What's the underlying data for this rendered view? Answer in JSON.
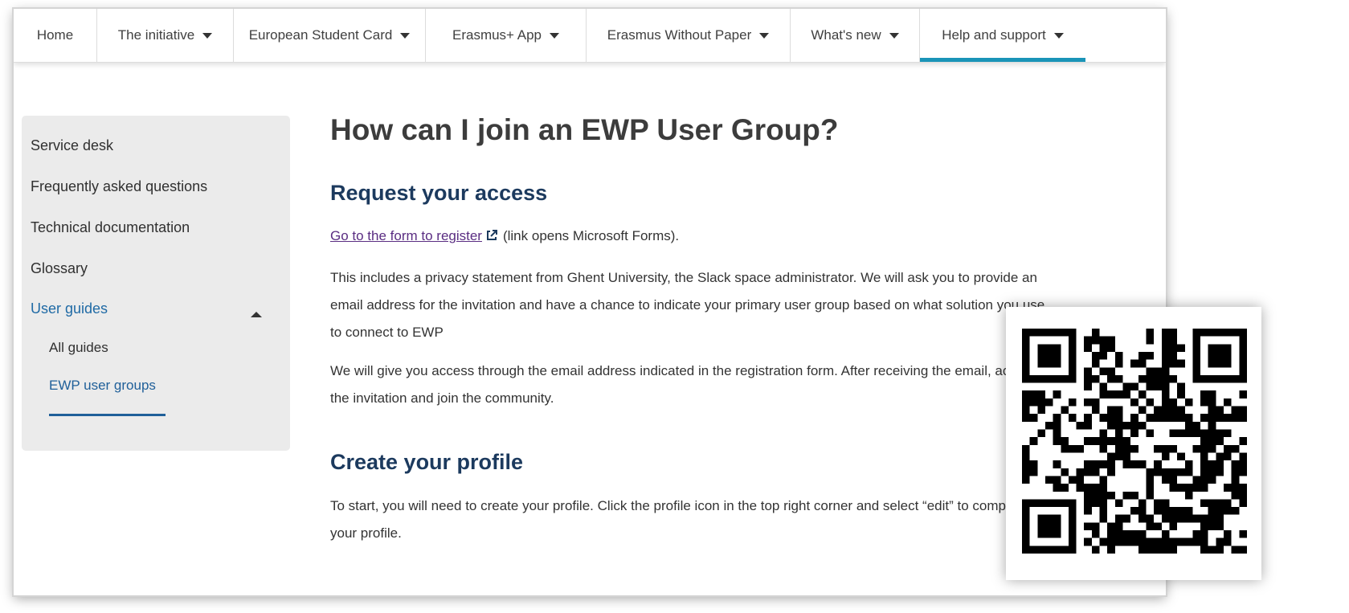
{
  "nav": {
    "items": [
      {
        "label": "Home",
        "dropdown": false,
        "active": false
      },
      {
        "label": "The initiative",
        "dropdown": true,
        "active": false
      },
      {
        "label": "European Student Card",
        "dropdown": true,
        "active": false
      },
      {
        "label": "Erasmus+ App",
        "dropdown": true,
        "active": false
      },
      {
        "label": "Erasmus Without Paper",
        "dropdown": true,
        "active": false
      },
      {
        "label": "What's new",
        "dropdown": true,
        "active": false
      },
      {
        "label": "Help and support",
        "dropdown": true,
        "active": true
      }
    ],
    "accent_color": "#1a94b8"
  },
  "sidebar": {
    "items": [
      {
        "label": "Service desk"
      },
      {
        "label": "Frequently asked questions"
      },
      {
        "label": "Technical documentation"
      },
      {
        "label": "Glossary"
      },
      {
        "label": "User guides",
        "expanded": true
      }
    ],
    "sub_items": [
      {
        "label": "All guides"
      },
      {
        "label": "EWP user groups",
        "current": true
      }
    ]
  },
  "page": {
    "title": "How can I join an EWP User Group?",
    "section1": {
      "heading": "Request your access",
      "link_text": "Go to the form to register",
      "link_suffix": "(link opens Microsoft Forms).",
      "para1": "This includes a privacy statement from Ghent University, the Slack space administrator. We will ask you to provide an email address for the invitation and have a chance to indicate your primary user group based on what solution you use to connect to EWP",
      "para2": "We will give you access through the email address indicated in the registration form. After receiving the email, accept the invitation and join the community."
    },
    "section2": {
      "heading": "Create your profile",
      "para1": "To start, you will need to create your profile. Click the profile icon in the top right corner and select “edit” to complete your profile."
    }
  },
  "icons": {
    "caret": "chevron-down-icon",
    "external": "external-link-icon",
    "qr": "qr-code-icon"
  },
  "colors": {
    "heading": "#1c3a5e",
    "link": "#5a2d82",
    "sidebar_active": "#1f6aa5",
    "sidebar_bg": "#ebebeb"
  }
}
